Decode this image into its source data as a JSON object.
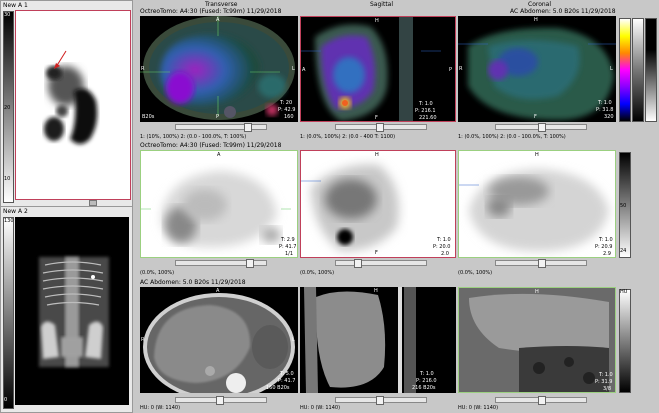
{
  "left_panels": [
    {
      "title": "New A 1",
      "scale_top": "30",
      "scale_mid1": "20",
      "scale_mid2": "10",
      "scale_bottom": "0"
    },
    {
      "title": "New A 2",
      "scale_top": "130",
      "scale_mid1": "",
      "scale_mid2": "",
      "scale_bottom": "0"
    }
  ],
  "fusion_row": {
    "header_left": "OctreoTomo: A4:30 (Fused: Tc99m) 11/29/2018",
    "header_trans": "Transverse",
    "header_sag": "Sagittal",
    "header_cor": "Coronal",
    "header_right": "AC Abdomen: 5.0 B20s 11/29/2018",
    "trans_info": [
      "T: 20",
      "P: 42.9",
      "160"
    ],
    "sag_info": [
      "T: 1.0",
      "P: 216.1",
      "221.60"
    ],
    "cor_info": [
      "T: 1.0",
      "P: 31.8",
      "320"
    ],
    "zoom": "B20s",
    "footer_trans": "1: (10%, 100%)   2: (0.0 - 100.0%, T: 100%)",
    "footer_sag": "1: (0.0%, 100%)   2: (0.0 - 400 T: 1100)",
    "footer_cor": "1: (0.0%, 100%)   2: (0.0 - 100.0%, T: 100%)"
  },
  "spect_row": {
    "header_left": "OctreoTomo: A4:30 (Fused: Tc99m) 11/29/2018",
    "trans_info": [
      "T: 2.9",
      "P: 41.7",
      "1/1"
    ],
    "sag_info": [
      "T: 1.0",
      "P: 20.0",
      "2.0"
    ],
    "cor_info": [
      "T: 1.0",
      "P: 20.9",
      "2.9"
    ],
    "scale_top": "50",
    "scale_mid": "24",
    "footer_trans": "(0.0%, 100%)",
    "footer_sag": "(0.0%, 100%)",
    "footer_cor": "(0.0%, 100%)"
  },
  "ct_row": {
    "header_left": "AC Abdomen: 5.0 B20s 11/29/2018",
    "trans_info": [
      "T: 5.0",
      "P: 41.7",
      "160 B20s"
    ],
    "sag_info": [
      "T: 1.0",
      "P: 216.0",
      "216 B20s"
    ],
    "cor_info": [
      "T: 1.0",
      "P: 31.9",
      "3/8"
    ],
    "scale_top": "HU",
    "footer_trans": "HU: 0 (W: 1140)",
    "footer_sag": "HU: 0 (W: 1140)",
    "footer_cor": "HU: 0 (W: 1140)"
  },
  "orient": {
    "A": "A",
    "P": "P",
    "R": "R",
    "L": "L",
    "H": "H",
    "F": "F"
  },
  "colors": {
    "frame_red": "#c0405a",
    "frame_green": "#9bd080",
    "bg": "#c8c8c8"
  }
}
